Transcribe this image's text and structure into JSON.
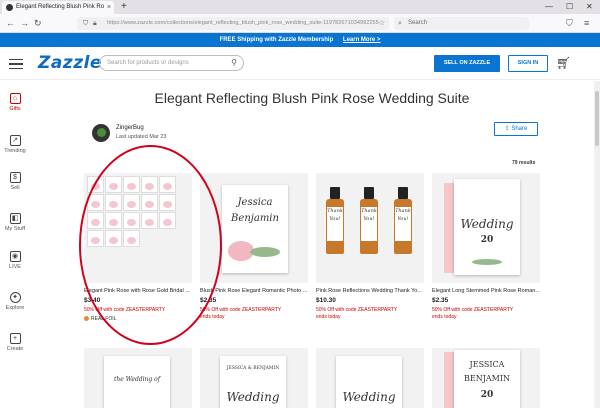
{
  "browser": {
    "tab_title": "Elegant Reflecting Blush Pink Ro",
    "url": "https://www.zazzle.com/collections/elegant_reflecting_blush_pink_rose_wedding_suite-119782671034992255",
    "search_placeholder": "Search"
  },
  "promo": {
    "text": "FREE Shipping with Zazzle Membership",
    "link": "Learn More >"
  },
  "header": {
    "logo": "Zazzle",
    "search_placeholder": "Search for products or designs",
    "sell_label": "SELL ON ZAZZLE",
    "signin_label": "SIGN IN"
  },
  "sidenav": [
    {
      "label": "Gifts",
      "icon": "gift-icon"
    },
    {
      "label": "Trending",
      "icon": "trending-icon"
    },
    {
      "label": "Sell",
      "icon": "dollar-icon"
    },
    {
      "label": "My Stuff",
      "icon": "mystuff-icon"
    },
    {
      "label": "LIVE",
      "icon": "live-icon"
    },
    {
      "label": "Explore",
      "icon": "explore-icon"
    },
    {
      "label": "Create",
      "icon": "create-icon"
    }
  ],
  "collection": {
    "title": "Elegant Reflecting Blush Pink Rose Wedding Suite",
    "author": "ZingerBug",
    "updated": "Last updated Mar 23",
    "share_label": "Share",
    "results": "79 results"
  },
  "products": [
    {
      "name": "Elegant Pink Rose with Rose Gold Bridal ...",
      "price": "$3.40",
      "discount": "50% Off with code ZEASTERPARTY",
      "badge": "REAL FOIL"
    },
    {
      "name": "Blush Pink Rose Elegant Romantic Photo ...",
      "price": "$2.35",
      "discount": "50% Off with code ZEASTERPARTY",
      "ends": "ends today",
      "art_title": "Jessica",
      "art_subtitle": "Benjamin"
    },
    {
      "name": "Pink Rose Reflections Wedding Thank Yo...",
      "price": "$10.30",
      "discount": "50% Off with code ZEASTERPARTY",
      "ends": "ends today",
      "art_text": "Thank You!"
    },
    {
      "name": "Elegant Long Stemmed Pink Rose Roman...",
      "price": "$2.35",
      "discount": "50% Off with code ZEASTERPARTY",
      "ends": "ends today",
      "art_title": "Wedding",
      "art_day": "20"
    }
  ],
  "row2": [
    {
      "art_title": "the Wedding of"
    },
    {
      "art_title": "Wedding",
      "art_names": "JESSICA & BENJAMIN"
    },
    {
      "art_title": "Wedding"
    },
    {
      "art_title": "JESSICA",
      "art_subtitle": "BENJAMIN",
      "art_day": "20"
    }
  ]
}
